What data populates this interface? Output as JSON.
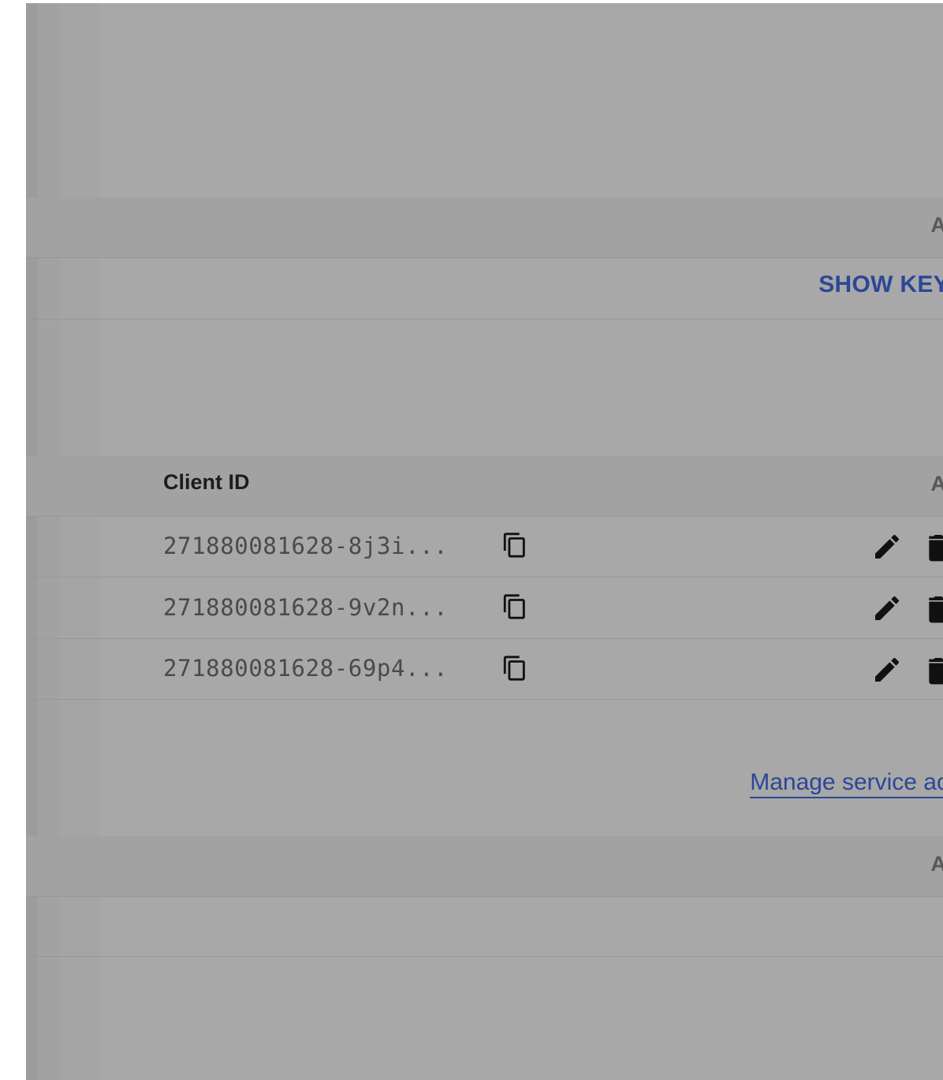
{
  "api_keys": {
    "header_truncated": "A",
    "show_key_label": "SHOW KEY"
  },
  "oauth_clients": {
    "column_client_id": "Client ID",
    "header_truncated": "A",
    "rows": [
      {
        "client_id": "271880081628-8j3i..."
      },
      {
        "client_id": "271880081628-9v2n..."
      },
      {
        "client_id": "271880081628-69p4..."
      }
    ],
    "icons": {
      "copy": "copy-icon",
      "edit": "pencil-icon",
      "delete": "trash-icon"
    }
  },
  "service_accounts": {
    "manage_link": "Manage service acc",
    "header_truncated": "A"
  },
  "colors": {
    "overlay_gray": "#a8a8a8",
    "link_blue": "#2c4796"
  }
}
